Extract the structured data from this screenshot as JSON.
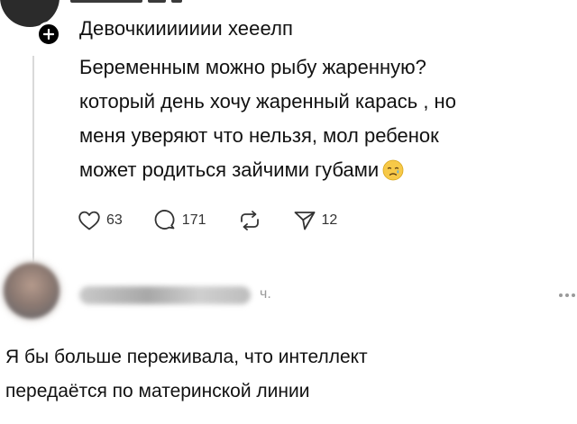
{
  "post": {
    "title": "Девочкиииииии хееелп",
    "body": [
      "Беременным можно рыбу жаренную?",
      "который день хочу жаренный карась , но",
      "меня уверяют что нельзя, мол ребенок",
      "может родиться зайчими губами"
    ],
    "emoji": "crying-face-emoji",
    "actions": {
      "likes": "63",
      "comments": "171",
      "shares": "12"
    }
  },
  "reply": {
    "time": "ч.",
    "body": [
      "Я бы больше переживала, что интеллект",
      "передаётся по материнской линии"
    ]
  },
  "colors": {
    "text": "#111111",
    "muted": "#9a9a9a",
    "thread_line": "#d9d9d9",
    "emoji_yellow": "#f7c948",
    "tear_blue": "#5ab0e8"
  }
}
